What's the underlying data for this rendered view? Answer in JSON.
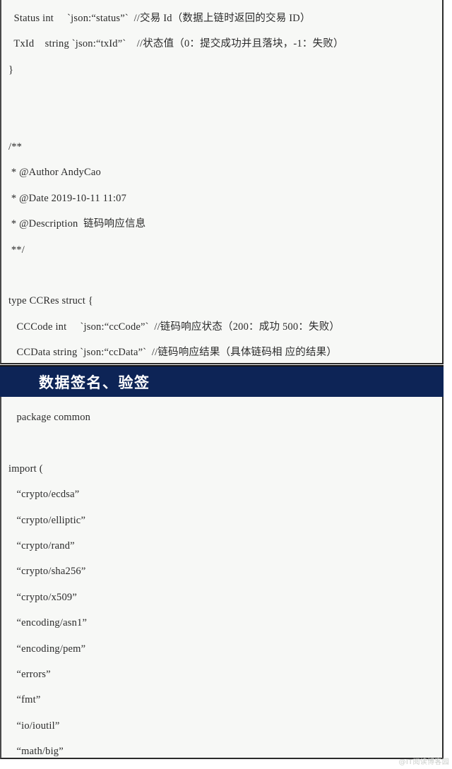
{
  "code_block_1": {
    "name": "go-struct-ccres-declaration",
    "lines": [
      "  Status int     `json:“status”`  //交易 Id（数据上链时返回的交易 ID）",
      "  TxId    string `json:“txId”`    //状态值（0：提交成功并且落块，-1：失败）",
      "}",
      "",
      "",
      "/**",
      " * @Author AndyCao",
      " * @Date 2019-10-11 11:07",
      " * @Description  链码响应信息",
      " **/",
      "",
      "type CCRes struct {",
      "   CCCode int     `json:“ccCode”`  //链码响应状态（200：成功 500：失败）",
      "   CCData string `json:“ccData”`  //链码响应结果（具体链码相 应的结果）",
      "}"
    ]
  },
  "section_banner": {
    "title": "数据签名、验签",
    "background_color": "#0d2456",
    "text_color": "#ffffff"
  },
  "code_block_2": {
    "name": "go-package-common-imports",
    "lines": [
      "   package common",
      "",
      "import (",
      "   “crypto/ecdsa”",
      "   “crypto/elliptic”",
      "   “crypto/rand”",
      "   “crypto/sha256”",
      "   “crypto/x509”",
      "   “encoding/asn1”",
      "   “encoding/pem”",
      "   “errors”",
      "   “fmt”",
      "   “io/ioutil”",
      "   “math/big”"
    ]
  },
  "watermark": {
    "text": "@IT阅读博客园"
  },
  "colors": {
    "page_background": "#ffffff",
    "code_background": "#f7f8f6",
    "code_text": "#2a2a2a",
    "border": "#2b2b2b",
    "accent_navy": "#0d2456"
  }
}
